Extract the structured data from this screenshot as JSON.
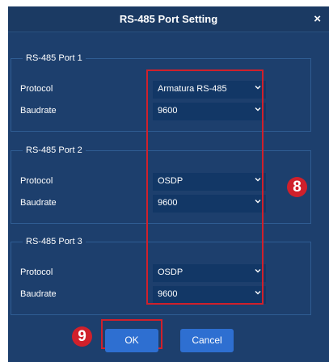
{
  "dialog": {
    "title": "RS-485 Port Setting",
    "close_label": "×"
  },
  "ports": [
    {
      "legend": "RS-485 Port 1",
      "protocol_label": "Protocol",
      "protocol_value": "Armatura RS-485",
      "baudrate_label": "Baudrate",
      "baudrate_value": "9600"
    },
    {
      "legend": "RS-485 Port 2",
      "protocol_label": "Protocol",
      "protocol_value": "OSDP",
      "baudrate_label": "Baudrate",
      "baudrate_value": "9600"
    },
    {
      "legend": "RS-485 Port 3",
      "protocol_label": "Protocol",
      "protocol_value": "OSDP",
      "baudrate_label": "Baudrate",
      "baudrate_value": "9600"
    }
  ],
  "buttons": {
    "ok_label": "OK",
    "cancel_label": "Cancel"
  },
  "annotations": {
    "marker_8": "8",
    "marker_9": "9"
  },
  "colors": {
    "accent": "#2e6fd1",
    "annotation_red": "#d0202b",
    "dialog_bg": "#1d3f6d",
    "select_bg": "#123766"
  },
  "icons": {
    "close": "close-icon",
    "dropdown": "chevron-down-icon"
  }
}
